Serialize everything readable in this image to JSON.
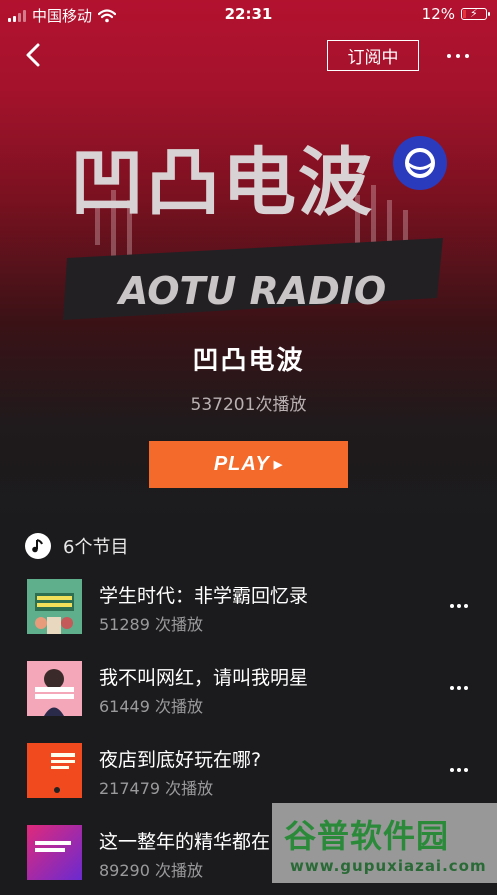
{
  "status_bar": {
    "carrier": "中国移动",
    "time": "22:31",
    "battery": "12%",
    "battery_level": 0.12
  },
  "header": {
    "subscribe_label": "订阅中"
  },
  "cover": {
    "chinese_logo": "凹凸电波",
    "english_logo": "AOTU RADIO"
  },
  "album": {
    "title": "凹凸电波",
    "plays": "537201次播放",
    "play_label": "PLAY"
  },
  "episodes_count": "6个节目",
  "episodes": [
    {
      "title": "学生时代：非学霸回忆录",
      "plays": "51289 次播放"
    },
    {
      "title": "我不叫网红，请叫我明星",
      "plays": "61449 次播放"
    },
    {
      "title": "夜店到底好玩在哪?",
      "plays": "217479 次播放"
    },
    {
      "title": "这一整年的精华都在",
      "plays": "89290 次播放"
    }
  ],
  "watermark": {
    "logo": "谷普软件园",
    "url": "www.gupuxiazai.com"
  },
  "colors": {
    "play_button": "#f46a2a",
    "hero_top": "#b3122f",
    "background": "#1b1b1d"
  }
}
